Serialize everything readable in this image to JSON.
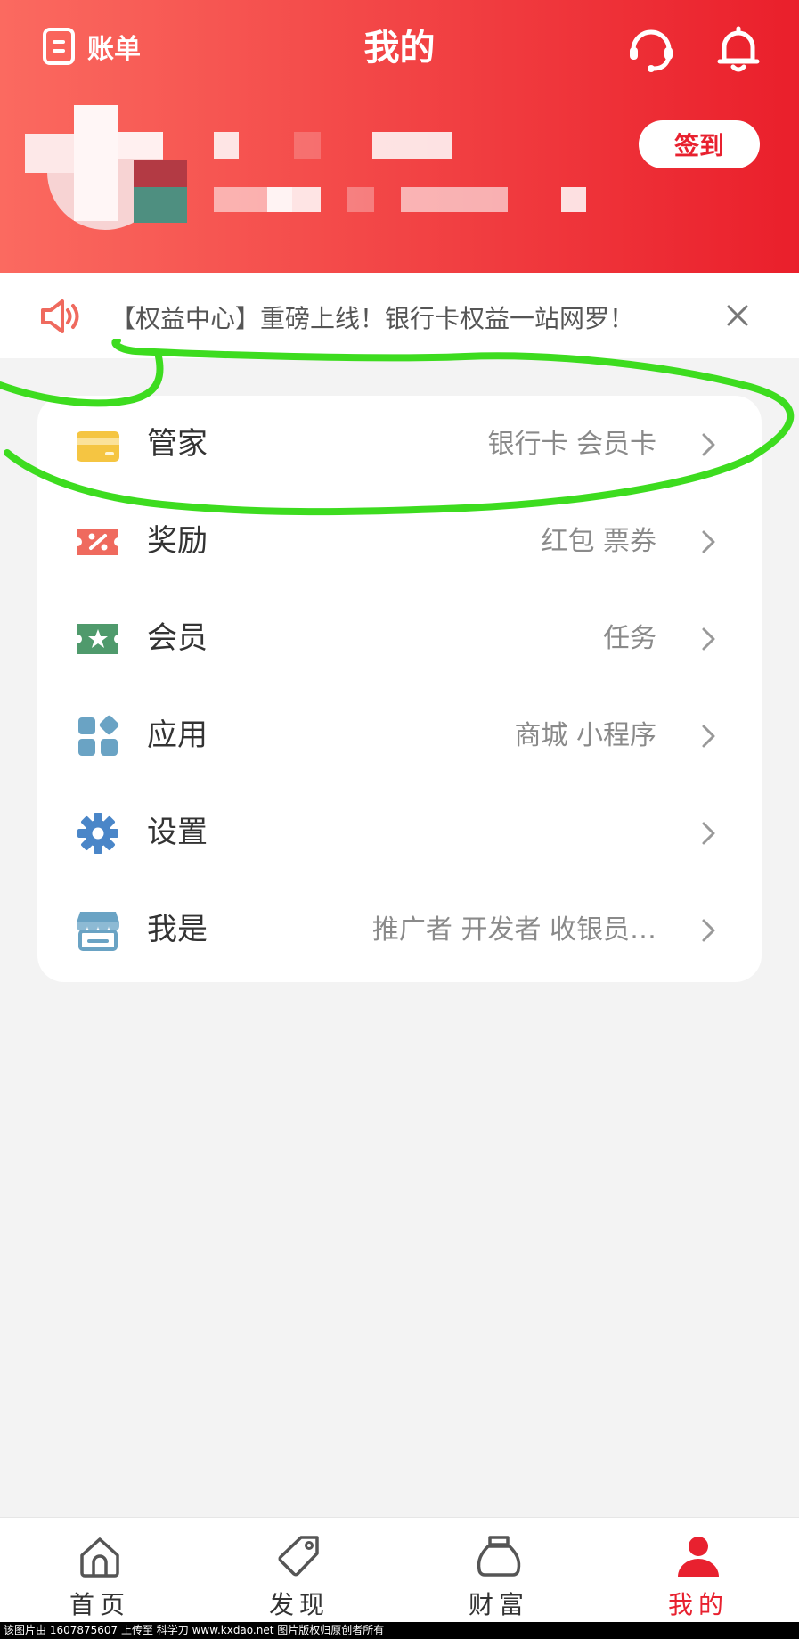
{
  "header": {
    "bill_label": "账单",
    "title": "我的",
    "signin_label": "签到"
  },
  "notice": {
    "text": "【权益中心】重磅上线！银行卡权益一站网罗！"
  },
  "menu": [
    {
      "label": "管家",
      "sub": "银行卡 会员卡",
      "icon": "card-icon"
    },
    {
      "label": "奖励",
      "sub": "红包 票券",
      "icon": "coupon-icon"
    },
    {
      "label": "会员",
      "sub": "任务",
      "icon": "member-ticket-icon"
    },
    {
      "label": "应用",
      "sub": "商城 小程序",
      "icon": "apps-grid-icon"
    },
    {
      "label": "设置",
      "sub": "",
      "icon": "gear-icon"
    },
    {
      "label": "我是",
      "sub": "推广者 开发者 收银员…",
      "icon": "store-icon"
    }
  ],
  "tabs": [
    {
      "label": "首页",
      "icon": "home-icon"
    },
    {
      "label": "发现",
      "icon": "tag-icon"
    },
    {
      "label": "财富",
      "icon": "money-bag-icon"
    },
    {
      "label": "我的",
      "icon": "user-icon",
      "active": true
    }
  ],
  "footer": {
    "text": "该图片由 1607875607 上传至 科学刀 www.kxdao.net 图片版权归原创者所有"
  },
  "colors": {
    "accent": "#e8212f",
    "annotation": "#3ddc1f"
  }
}
